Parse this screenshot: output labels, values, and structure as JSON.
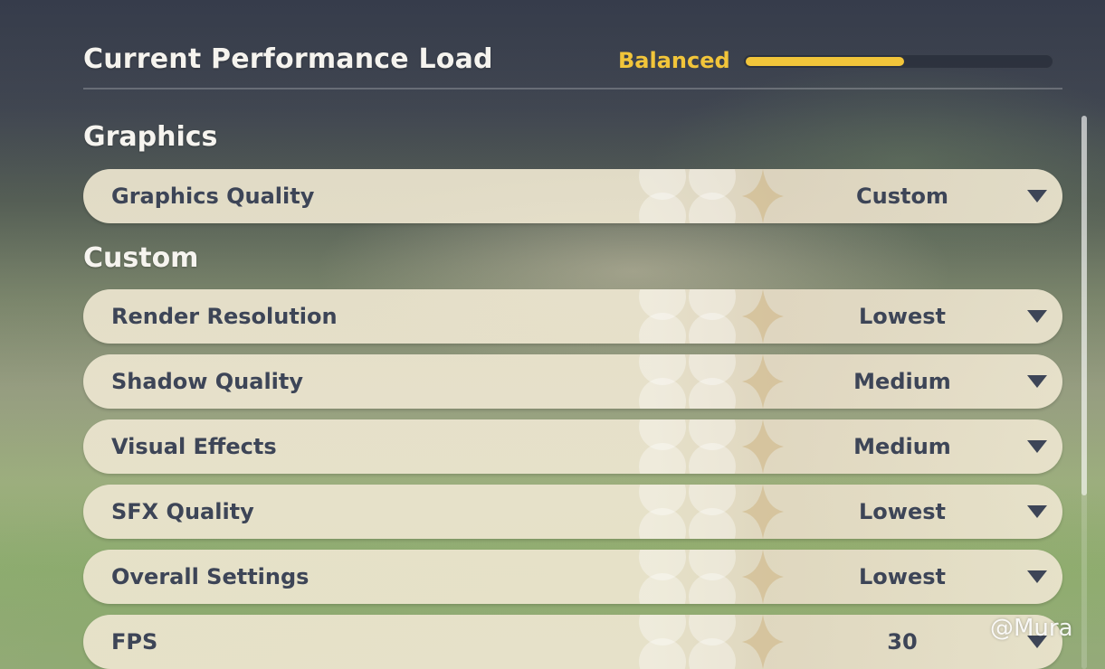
{
  "performance": {
    "title": "Current Performance Load",
    "level_label": "Balanced",
    "level_fraction": 0.52,
    "bar_color": "#f2c53a"
  },
  "sections": {
    "graphics": "Graphics",
    "custom": "Custom"
  },
  "graphics_quality": {
    "label": "Graphics Quality",
    "value": "Custom"
  },
  "settings": [
    {
      "label": "Render Resolution",
      "value": "Lowest"
    },
    {
      "label": "Shadow Quality",
      "value": "Medium"
    },
    {
      "label": "Visual Effects",
      "value": "Medium"
    },
    {
      "label": "SFX Quality",
      "value": "Lowest"
    },
    {
      "label": "Overall Settings",
      "value": "Lowest"
    },
    {
      "label": "FPS",
      "value": "30"
    }
  ],
  "icons": {
    "dropdown": "caret-down-icon"
  },
  "watermark": "@Mura",
  "colors": {
    "row_text": "#3d4557",
    "row_background": "#ece5cf",
    "accent": "#f2c53a"
  }
}
